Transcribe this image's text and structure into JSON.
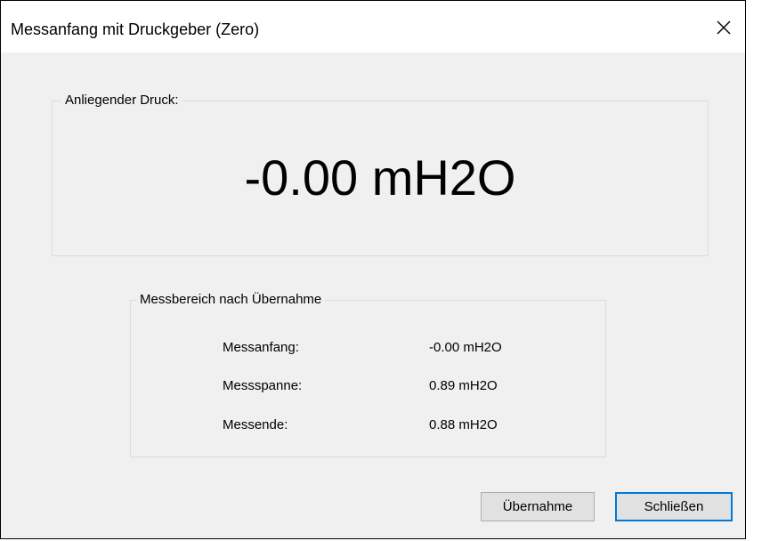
{
  "window": {
    "title": "Messanfang mit Druckgeber (Zero)",
    "close_icon": "close-icon"
  },
  "pressure_group": {
    "label": "Anliegender Druck:",
    "value": "-0.00 mH2O"
  },
  "range_group": {
    "label": "Messbereich nach Übernahme",
    "rows": [
      {
        "label": "Messanfang:",
        "value": "-0.00 mH2O"
      },
      {
        "label": "Messspanne:",
        "value": "0.89 mH2O"
      },
      {
        "label": "Messende:",
        "value": "0.88 mH2O"
      }
    ]
  },
  "buttons": {
    "apply_label": "Übernahme",
    "close_label": "Schließen"
  },
  "colors": {
    "dialog_background": "#f0f0f0",
    "focus_border": "#0078d7"
  }
}
